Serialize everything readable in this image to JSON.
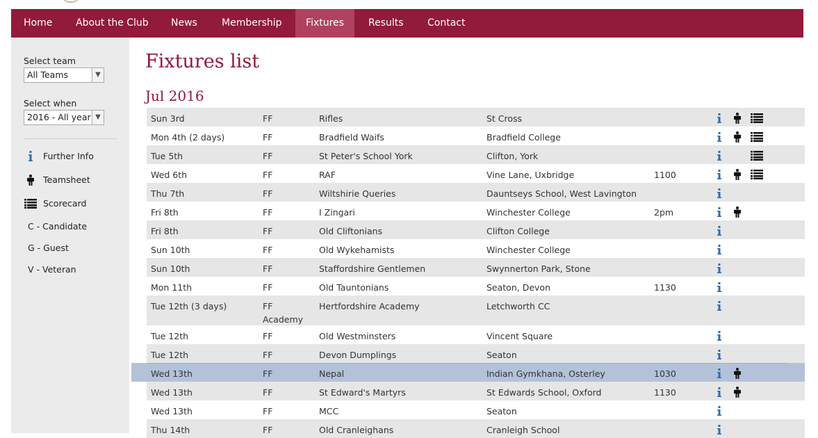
{
  "colors": {
    "brand": "#921a3a",
    "brand_active": "#b0425f",
    "info": "#2b6cb0",
    "highlight_row": "#b3c2d9"
  },
  "nav": {
    "items": [
      {
        "label": "Home"
      },
      {
        "label": "About the Club"
      },
      {
        "label": "News"
      },
      {
        "label": "Membership"
      },
      {
        "label": "Fixtures"
      },
      {
        "label": "Results"
      },
      {
        "label": "Contact"
      }
    ],
    "active": "Fixtures"
  },
  "sidebar": {
    "team_label": "Select team",
    "team_value": "All Teams",
    "when_label": "Select when",
    "when_value": "2016 - All year",
    "legend": [
      {
        "icon": "info-icon",
        "label": "Further Info"
      },
      {
        "icon": "teamsheet-icon",
        "label": "Teamsheet"
      },
      {
        "icon": "scorecard-icon",
        "label": "Scorecard"
      }
    ],
    "keys": [
      "C - Candidate",
      "G - Guest",
      "V - Veteran"
    ]
  },
  "page_title": "Fixtures list",
  "month": "Jul 2016",
  "fixtures": [
    {
      "date": "Sun 3rd",
      "type": "FF",
      "opponent": "Rifles",
      "venue": "St Cross",
      "time": "",
      "info": true,
      "team": true,
      "score": true
    },
    {
      "date": "Mon 4th (2 days)",
      "type": "FF",
      "opponent": "Bradfield Waifs",
      "venue": "Bradfield College",
      "time": "",
      "info": true,
      "team": true,
      "score": true
    },
    {
      "date": "Tue 5th",
      "type": "FF",
      "opponent": "St Peter's School York",
      "venue": "Clifton, York",
      "time": "",
      "info": true,
      "team": false,
      "score": true
    },
    {
      "date": "Wed 6th",
      "type": "FF",
      "opponent": "RAF",
      "venue": "Vine Lane, Uxbridge",
      "time": "1100",
      "info": true,
      "team": true,
      "score": true
    },
    {
      "date": "Thu 7th",
      "type": "FF",
      "opponent": "Wiltshirie Queries",
      "venue": "Dauntseys School, West Lavington",
      "time": "",
      "info": true,
      "team": false,
      "score": false
    },
    {
      "date": "Fri 8th",
      "type": "FF",
      "opponent": "I Zingari",
      "venue": "Winchester College",
      "time": "2pm",
      "info": true,
      "team": true,
      "score": false
    },
    {
      "date": "Fri 8th",
      "type": "FF",
      "opponent": "Old Cliftonians",
      "venue": "Clifton College",
      "time": "",
      "info": true,
      "team": false,
      "score": false
    },
    {
      "date": "Sun 10th",
      "type": "FF",
      "opponent": "Old Wykehamists",
      "venue": "Winchester College",
      "time": "",
      "info": true,
      "team": false,
      "score": false
    },
    {
      "date": "Sun 10th",
      "type": "FF",
      "opponent": "Staffordshire Gentlemen",
      "venue": "Swynnerton Park, Stone",
      "time": "",
      "info": true,
      "team": false,
      "score": false
    },
    {
      "date": "Mon 11th",
      "type": "FF",
      "opponent": "Old Tauntonians",
      "venue": "Seaton, Devon",
      "time": "1130",
      "info": true,
      "team": false,
      "score": false
    },
    {
      "date": "Tue 12th (3 days)",
      "type": "FF Academy",
      "opponent": "Hertfordshire Academy",
      "venue": "Letchworth CC",
      "time": "",
      "info": true,
      "team": false,
      "score": false
    },
    {
      "date": "Tue 12th",
      "type": "FF",
      "opponent": "Old Westminsters",
      "venue": "Vincent Square",
      "time": "",
      "info": true,
      "team": false,
      "score": false
    },
    {
      "date": "Tue 12th",
      "type": "FF",
      "opponent": "Devon Dumplings",
      "venue": "Seaton",
      "time": "",
      "info": true,
      "team": false,
      "score": false
    },
    {
      "date": "Wed 13th",
      "type": "FF",
      "opponent": "Nepal",
      "venue": "Indian Gymkhana, Osterley",
      "time": "1030",
      "info": true,
      "team": true,
      "score": false
    },
    {
      "date": "Wed 13th",
      "type": "FF",
      "opponent": "St Edward's Martyrs",
      "venue": "St Edwards School, Oxford",
      "time": "1130",
      "info": true,
      "team": true,
      "score": false
    },
    {
      "date": "Wed 13th",
      "type": "FF",
      "opponent": "MCC",
      "venue": "Seaton",
      "time": "",
      "info": true,
      "team": false,
      "score": false
    },
    {
      "date": "Thu 14th",
      "type": "FF",
      "opponent": "Old Cranleighans",
      "venue": "Cranleigh School",
      "time": "",
      "info": true,
      "team": false,
      "score": false
    }
  ]
}
